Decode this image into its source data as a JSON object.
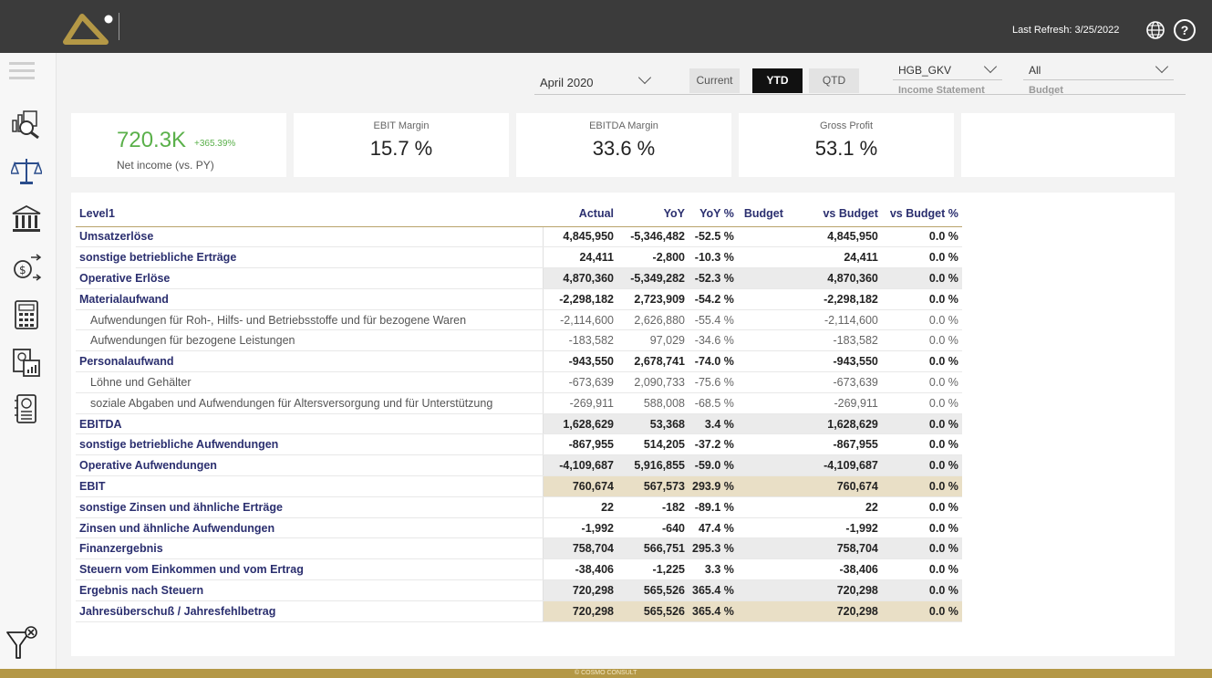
{
  "header": {
    "last_refresh": "Last Refresh: 3/25/2022",
    "help_label": "?"
  },
  "slicers": {
    "period": "April 2020",
    "tabs": [
      "Current",
      "YTD",
      "QTD"
    ],
    "active_tab": "YTD",
    "report": {
      "value": "HGB_GKV",
      "caption": "Income Statement"
    },
    "budget": {
      "value": "All",
      "caption": "Budget"
    }
  },
  "cards": {
    "net_income": {
      "value": "720.3K",
      "change": "+365.39%",
      "label": "Net income (vs. PY)"
    },
    "ebit_margin": {
      "title": "EBIT Margin",
      "value": "15.7 %"
    },
    "ebitda_margin": {
      "title": "EBITDA Margin",
      "value": "33.6 %"
    },
    "gross_profit": {
      "title": "Gross Profit",
      "value": "53.1 %"
    }
  },
  "table": {
    "columns": [
      "Level1",
      "Actual",
      "YoY",
      "YoY %",
      "Budget",
      "vs Budget",
      "vs Budget %"
    ],
    "rows": [
      {
        "label": "Umsatzerlöse",
        "style": "bold",
        "cells": [
          "4,845,950",
          "-5,346,482",
          "-52.5 %",
          "",
          "4,845,950",
          "0.0 %"
        ]
      },
      {
        "label": "sonstige betriebliche Erträge",
        "style": "bold",
        "cells": [
          "24,411",
          "-2,800",
          "-10.3 %",
          "",
          "24,411",
          "0.0 %"
        ]
      },
      {
        "label": "Operative Erlöse",
        "style": "gray",
        "cells": [
          "4,870,360",
          "-5,349,282",
          "-52.3 %",
          "",
          "4,870,360",
          "0.0 %"
        ]
      },
      {
        "label": "Materialaufwand",
        "style": "bold",
        "cells": [
          "-2,298,182",
          "2,723,909",
          "-54.2 %",
          "",
          "-2,298,182",
          "0.0 %"
        ]
      },
      {
        "label": "Aufwendungen für Roh-, Hilfs- und Betriebsstoffe und für bezogene Waren",
        "style": "sub",
        "cells": [
          "-2,114,600",
          "2,626,880",
          "-55.4 %",
          "",
          "-2,114,600",
          "0.0 %"
        ]
      },
      {
        "label": "Aufwendungen für bezogene Leistungen",
        "style": "sub",
        "cells": [
          "-183,582",
          "97,029",
          "-34.6 %",
          "",
          "-183,582",
          "0.0 %"
        ]
      },
      {
        "label": "Personalaufwand",
        "style": "bold",
        "cells": [
          "-943,550",
          "2,678,741",
          "-74.0 %",
          "",
          "-943,550",
          "0.0 %"
        ]
      },
      {
        "label": "Löhne und Gehälter",
        "style": "sub",
        "cells": [
          "-673,639",
          "2,090,733",
          "-75.6 %",
          "",
          "-673,639",
          "0.0 %"
        ]
      },
      {
        "label": "soziale Abgaben und Aufwendungen für Altersversorgung und für Unterstützung",
        "style": "sub",
        "cells": [
          "-269,911",
          "588,008",
          "-68.5 %",
          "",
          "-269,911",
          "0.0 %"
        ]
      },
      {
        "label": "EBITDA",
        "style": "gray",
        "cells": [
          "1,628,629",
          "53,368",
          "3.4 %",
          "",
          "1,628,629",
          "0.0 %"
        ]
      },
      {
        "label": "sonstige betriebliche Aufwendungen",
        "style": "bold",
        "cells": [
          "-867,955",
          "514,205",
          "-37.2 %",
          "",
          "-867,955",
          "0.0 %"
        ]
      },
      {
        "label": "Operative Aufwendungen",
        "style": "gray",
        "cells": [
          "-4,109,687",
          "5,916,855",
          "-59.0 %",
          "",
          "-4,109,687",
          "0.0 %"
        ]
      },
      {
        "label": "EBIT",
        "style": "tan",
        "cells": [
          "760,674",
          "567,573",
          "293.9 %",
          "",
          "760,674",
          "0.0 %"
        ]
      },
      {
        "label": "sonstige Zinsen und ähnliche Erträge",
        "style": "bold",
        "cells": [
          "22",
          "-182",
          "-89.1 %",
          "",
          "22",
          "0.0 %"
        ]
      },
      {
        "label": "Zinsen und ähnliche Aufwendungen",
        "style": "bold",
        "cells": [
          "-1,992",
          "-640",
          "47.4 %",
          "",
          "-1,992",
          "0.0 %"
        ]
      },
      {
        "label": "Finanzergebnis",
        "style": "gray",
        "cells": [
          "758,704",
          "566,751",
          "295.3 %",
          "",
          "758,704",
          "0.0 %"
        ]
      },
      {
        "label": "Steuern vom Einkommen und vom Ertrag",
        "style": "bold",
        "cells": [
          "-38,406",
          "-1,225",
          "3.3 %",
          "",
          "-38,406",
          "0.0 %"
        ]
      },
      {
        "label": "Ergebnis nach Steuern",
        "style": "gray",
        "cells": [
          "720,298",
          "565,526",
          "365.4 %",
          "",
          "720,298",
          "0.0 %"
        ]
      },
      {
        "label": "Jahresüberschuß / Jahresfehlbetrag",
        "style": "tan",
        "cells": [
          "720,298",
          "565,526",
          "365.4 %",
          "",
          "720,298",
          "0.0 %"
        ]
      }
    ]
  },
  "footer": {
    "text": "© COSMO CONSULT"
  },
  "icons": [
    "logo-icon",
    "globe-icon",
    "help-icon",
    "menu-icon",
    "analysis-icon",
    "balance-icon",
    "bank-icon",
    "cash-flow-icon",
    "calculator-icon",
    "document-icon",
    "notebook-icon",
    "clear-filter-icon"
  ],
  "colors": {
    "accent": "#b49846",
    "positive": "#5ab04a",
    "header_text": "#2b2f6f",
    "topbar": "#3b3b3b"
  }
}
